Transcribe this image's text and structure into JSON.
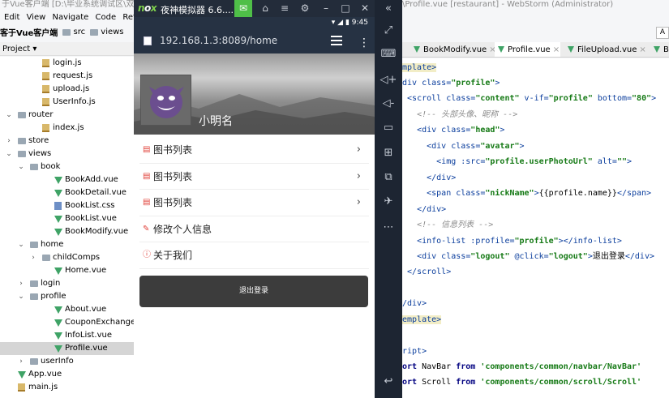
{
  "ide": {
    "title_left": "于Vue客户端 [D:\\毕业系统调试区\\双鱼",
    "menu": [
      "Edit",
      "View",
      "Navigate",
      "Code",
      "Refa"
    ],
    "breadcrumb": {
      "root": "客于Vue客户端",
      "src": "src",
      "views": "views"
    },
    "project_label": "Project ▾",
    "tree": [
      {
        "label": "login.js",
        "icon": "js",
        "depth": 4,
        "chev": ""
      },
      {
        "label": "request.js",
        "icon": "js",
        "depth": 4,
        "chev": ""
      },
      {
        "label": "upload.js",
        "icon": "js",
        "depth": 4,
        "chev": ""
      },
      {
        "label": "UserInfo.js",
        "icon": "js",
        "depth": 4,
        "chev": ""
      },
      {
        "label": "router",
        "icon": "folder",
        "depth": 2,
        "chev": "⌄"
      },
      {
        "label": "index.js",
        "icon": "js",
        "depth": 4,
        "chev": ""
      },
      {
        "label": "store",
        "icon": "folder",
        "depth": 2,
        "chev": "›"
      },
      {
        "label": "views",
        "icon": "folder",
        "depth": 2,
        "chev": "⌄"
      },
      {
        "label": "book",
        "icon": "folder",
        "depth": 3,
        "chev": "⌄"
      },
      {
        "label": "BookAdd.vue",
        "icon": "vue",
        "depth": 5,
        "chev": ""
      },
      {
        "label": "BookDetail.vue",
        "icon": "vue",
        "depth": 5,
        "chev": ""
      },
      {
        "label": "BookList.css",
        "icon": "css",
        "depth": 5,
        "chev": ""
      },
      {
        "label": "BookList.vue",
        "icon": "vue",
        "depth": 5,
        "chev": ""
      },
      {
        "label": "BookModify.vue",
        "icon": "vue",
        "depth": 5,
        "chev": ""
      },
      {
        "label": "home",
        "icon": "folder",
        "depth": 3,
        "chev": "⌄"
      },
      {
        "label": "childComps",
        "icon": "folder",
        "depth": 4,
        "chev": "›"
      },
      {
        "label": "Home.vue",
        "icon": "vue",
        "depth": 5,
        "chev": ""
      },
      {
        "label": "login",
        "icon": "folder",
        "depth": 3,
        "chev": "›"
      },
      {
        "label": "profile",
        "icon": "folder",
        "depth": 3,
        "chev": "⌄"
      },
      {
        "label": "About.vue",
        "icon": "vue",
        "depth": 5,
        "chev": ""
      },
      {
        "label": "CouponExchange.",
        "icon": "vue",
        "depth": 5,
        "chev": ""
      },
      {
        "label": "InfoList.vue",
        "icon": "vue",
        "depth": 5,
        "chev": ""
      },
      {
        "label": "Profile.vue",
        "icon": "vue",
        "depth": 5,
        "chev": "",
        "selected": true
      },
      {
        "label": "userInfo",
        "icon": "folder",
        "depth": 3,
        "chev": "›"
      },
      {
        "label": "App.vue",
        "icon": "vue",
        "depth": 2,
        "chev": ""
      },
      {
        "label": "main.js",
        "icon": "js",
        "depth": 2,
        "chev": ""
      }
    ]
  },
  "emulator": {
    "logo": "nox",
    "title": "夜神模拟器 6.6....",
    "status_time": "9:45",
    "url": "192.168.1.3:8089/home",
    "nickname": "小明名",
    "items": [
      {
        "label": "图书列表",
        "icon": "book-list-icon",
        "glyph": "▤",
        "arrow": true
      },
      {
        "label": "图书列表",
        "icon": "book-list-icon",
        "glyph": "▤",
        "arrow": true
      },
      {
        "label": "图书列表",
        "icon": "book-list-icon",
        "glyph": "▤",
        "arrow": true
      },
      {
        "label": "修改个人信息",
        "icon": "edit-icon",
        "glyph": "✎",
        "arrow": false
      },
      {
        "label": "关于我们",
        "icon": "info-icon",
        "glyph": "ⓘ",
        "arrow": false
      }
    ],
    "logout": "退出登录"
  },
  "editor": {
    "title_right": "\\Profile.vue [restaurant] - WebStorm (Administrator)",
    "right_btn": "A",
    "tabs": [
      {
        "label": "BookModify.vue",
        "active": false
      },
      {
        "label": "Profile.vue",
        "active": true
      },
      {
        "label": "FileUpload.vue",
        "active": false
      },
      {
        "label": "B",
        "active": false
      }
    ]
  },
  "colors": {
    "accent_green": "#4fbf48",
    "vue_green": "#3fa366",
    "tag_blue": "#0b3e9d",
    "string_green": "#167a16"
  }
}
